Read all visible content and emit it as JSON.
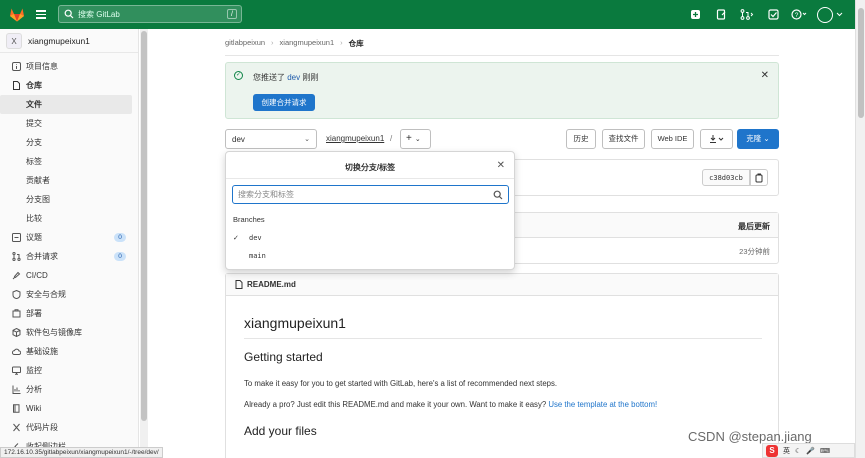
{
  "topbar": {
    "search_placeholder": "搜索 GitLab",
    "search_shortcut": "/",
    "brand_color": "#0a7a3e"
  },
  "sidebar": {
    "project_avatar": "X",
    "project_name": "xiangmupeixun1",
    "items": [
      {
        "label": "项目信息",
        "icon": "info-icon"
      },
      {
        "label": "仓库",
        "icon": "document-icon"
      },
      {
        "label": "文件",
        "sub": true,
        "active": true
      },
      {
        "label": "提交",
        "sub": true
      },
      {
        "label": "分支",
        "sub": true
      },
      {
        "label": "标签",
        "sub": true
      },
      {
        "label": "贡献者",
        "sub": true
      },
      {
        "label": "分支图",
        "sub": true
      },
      {
        "label": "比较",
        "sub": true
      },
      {
        "label": "议题",
        "icon": "issues-icon",
        "badge": "0"
      },
      {
        "label": "合并请求",
        "icon": "merge-request-icon",
        "badge": "0"
      },
      {
        "label": "CI/CD",
        "icon": "rocket-icon"
      },
      {
        "label": "安全与合规",
        "icon": "shield-icon"
      },
      {
        "label": "部署",
        "icon": "deploy-icon"
      },
      {
        "label": "软件包与镜像库",
        "icon": "package-icon"
      },
      {
        "label": "基础设施",
        "icon": "cloud-icon"
      },
      {
        "label": "监控",
        "icon": "monitor-icon"
      },
      {
        "label": "分析",
        "icon": "chart-icon"
      },
      {
        "label": "Wiki",
        "icon": "book-icon"
      },
      {
        "label": "代码片段",
        "icon": "snippet-icon"
      },
      {
        "label": "收起侧边栏",
        "icon": "collapse-icon"
      }
    ]
  },
  "status_url": "172.16.10.35/gitlabpeixun/xiangmupeixun1/-/tree/dev/",
  "breadcrumb": {
    "group": "gitlabpeixun",
    "project": "xiangmupeixun1",
    "current": "仓库"
  },
  "alert": {
    "message_prefix": "您推送了",
    "branch": "dev",
    "message_suffix": "刚刚",
    "button": "创建合并请求"
  },
  "toolbar": {
    "branch": "dev",
    "repo_path": "xiangmupeixun1",
    "path_sep": "/",
    "history": "历史",
    "find_file": "查找文件",
    "web_ide": "Web IDE",
    "clone": "克隆"
  },
  "commit": {
    "sha": "c38d03cb"
  },
  "file_table": {
    "last_update_header": "最后更新",
    "last_update_value": "23分钟前"
  },
  "readme": {
    "file_name": "README.md",
    "h1": "xiangmupeixun1",
    "h2_getting_started": "Getting started",
    "p1": "To make it easy for you to get started with GitLab, here's a list of recommended next steps.",
    "p2_text": "Already a pro? Just edit this README.md and make it your own. Want to make it easy? ",
    "p2_link": "Use the template at the bottom!",
    "h2_add_files": "Add your files"
  },
  "dropdown": {
    "title": "切换分支/标签",
    "search_placeholder": "搜索分支和标签",
    "section": "Branches",
    "branches": [
      {
        "name": "dev",
        "selected": true
      },
      {
        "name": "main",
        "selected": false
      }
    ]
  },
  "watermark": "CSDN @stepan.jiang",
  "tray": {
    "lang": "英"
  }
}
